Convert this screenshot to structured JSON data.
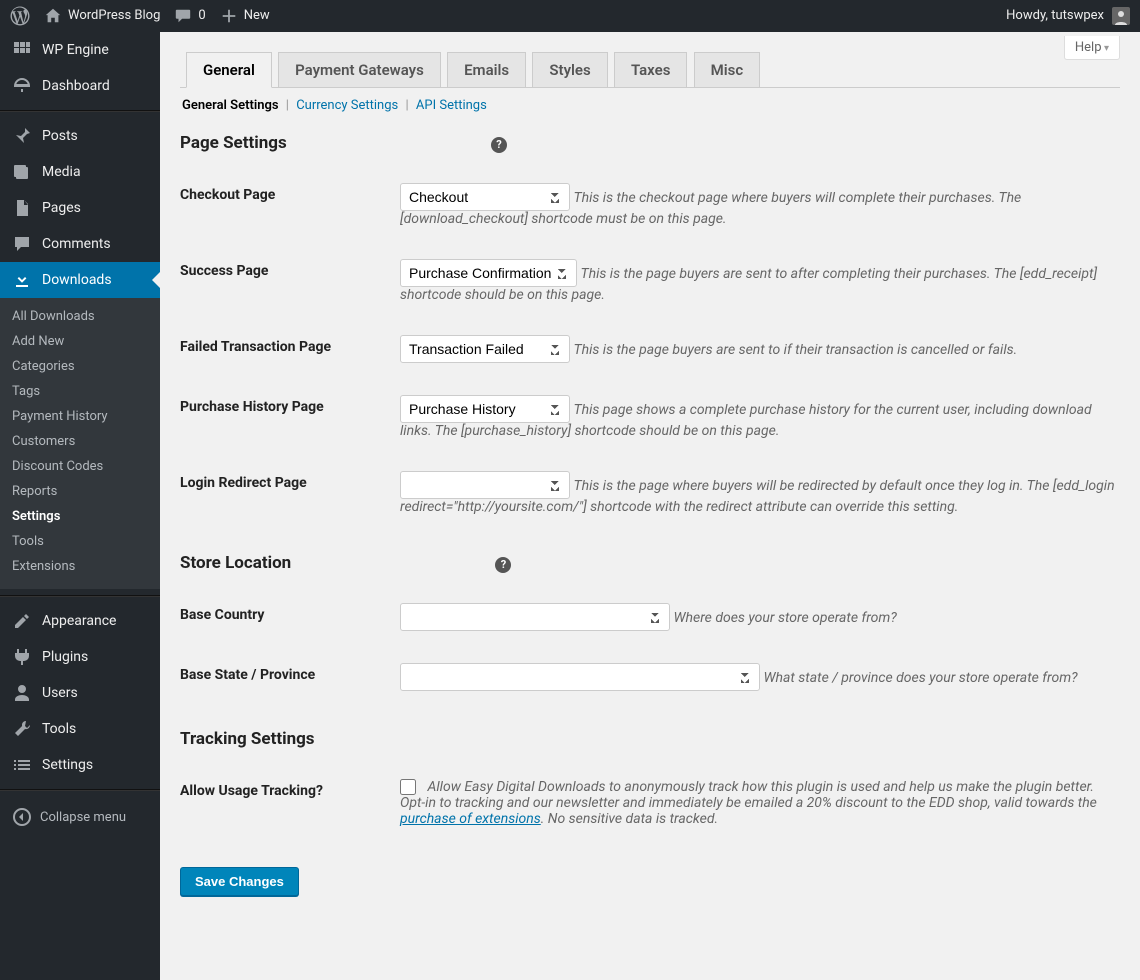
{
  "adminbar": {
    "site_name": "WordPress Blog",
    "comments_count": "0",
    "new_label": "New",
    "howdy": "Howdy, tutswpex"
  },
  "sidemenu": {
    "items": [
      {
        "label": "WP Engine",
        "icon": "wpengine"
      },
      {
        "label": "Dashboard",
        "icon": "dashboard"
      },
      {
        "label": "Posts",
        "icon": "pin"
      },
      {
        "label": "Media",
        "icon": "media"
      },
      {
        "label": "Pages",
        "icon": "pages"
      },
      {
        "label": "Comments",
        "icon": "comment"
      },
      {
        "label": "Downloads",
        "icon": "download",
        "current": true
      },
      {
        "label": "Appearance",
        "icon": "appearance"
      },
      {
        "label": "Plugins",
        "icon": "plugin"
      },
      {
        "label": "Users",
        "icon": "user"
      },
      {
        "label": "Tools",
        "icon": "tools"
      },
      {
        "label": "Settings",
        "icon": "settings"
      }
    ],
    "sub": [
      {
        "label": "All Downloads"
      },
      {
        "label": "Add New"
      },
      {
        "label": "Categories"
      },
      {
        "label": "Tags"
      },
      {
        "label": "Payment History"
      },
      {
        "label": "Customers"
      },
      {
        "label": "Discount Codes"
      },
      {
        "label": "Reports"
      },
      {
        "label": "Settings",
        "current": true
      },
      {
        "label": "Tools"
      },
      {
        "label": "Extensions"
      }
    ],
    "collapse": "Collapse menu"
  },
  "help": {
    "label": "Help"
  },
  "tabs": [
    {
      "label": "General",
      "active": true
    },
    {
      "label": "Payment Gateways"
    },
    {
      "label": "Emails"
    },
    {
      "label": "Styles"
    },
    {
      "label": "Taxes"
    },
    {
      "label": "Misc"
    }
  ],
  "subtabs": [
    {
      "label": "General Settings",
      "current": true
    },
    {
      "label": "Currency Settings"
    },
    {
      "label": "API Settings"
    }
  ],
  "sections": {
    "page": {
      "title": "Page Settings"
    },
    "store": {
      "title": "Store Location"
    },
    "tracking": {
      "title": "Tracking Settings"
    }
  },
  "fields": {
    "checkout": {
      "label": "Checkout Page",
      "value": "Checkout",
      "desc": "This is the checkout page where buyers will complete their purchases. The [download_checkout] shortcode must be on this page."
    },
    "success": {
      "label": "Success Page",
      "value": "Purchase Confirmation",
      "desc": "This is the page buyers are sent to after completing their purchases. The [edd_receipt] shortcode should be on this page."
    },
    "failed": {
      "label": "Failed Transaction Page",
      "value": "Transaction Failed",
      "desc": "This is the page buyers are sent to if their transaction is cancelled or fails."
    },
    "history": {
      "label": "Purchase History Page",
      "value": "Purchase History",
      "desc": "This page shows a complete purchase history for the current user, including download links. The [purchase_history] shortcode should be on this page."
    },
    "login": {
      "label": "Login Redirect Page",
      "value": "",
      "desc": "This is the page where buyers will be redirected by default once they log in. The [edd_login redirect=\"http://yoursite.com/\"] shortcode with the redirect attribute can override this setting."
    },
    "country": {
      "label": "Base Country",
      "value": "",
      "desc": "Where does your store operate from?"
    },
    "state": {
      "label": "Base State / Province",
      "value": "",
      "desc": "What state / province does your store operate from?"
    },
    "tracking": {
      "label": "Allow Usage Tracking?",
      "desc_pre": "Allow Easy Digital Downloads to anonymously track how this plugin is used and help us make the plugin better. Opt-in to tracking and our newsletter and immediately be emailed a 20% discount to the EDD shop, valid towards the ",
      "desc_link": "purchase of extensions",
      "desc_post": ". No sensitive data is tracked."
    }
  },
  "submit": {
    "label": "Save Changes"
  }
}
